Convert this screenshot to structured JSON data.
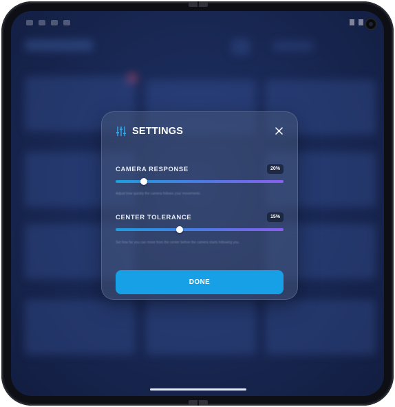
{
  "settings": {
    "title": "SETTINGS",
    "title_icon": "sliders-icon",
    "close_icon": "close-icon",
    "camera_response": {
      "label": "CAMERA RESPONSE",
      "value_text": "20%",
      "level": 0.17,
      "description": "Adjust how quickly the camera follows your movements."
    },
    "center_tolerance": {
      "label": "CENTER TOLERANCE",
      "value_text": "15%",
      "level": 0.38,
      "description": "Set how far you can move from the center before the camera starts following you."
    },
    "done_label": "DONE",
    "accent_color": "#17a0e6",
    "slider_gradient": [
      "#1b9fe0",
      "#8a5ef0"
    ]
  }
}
